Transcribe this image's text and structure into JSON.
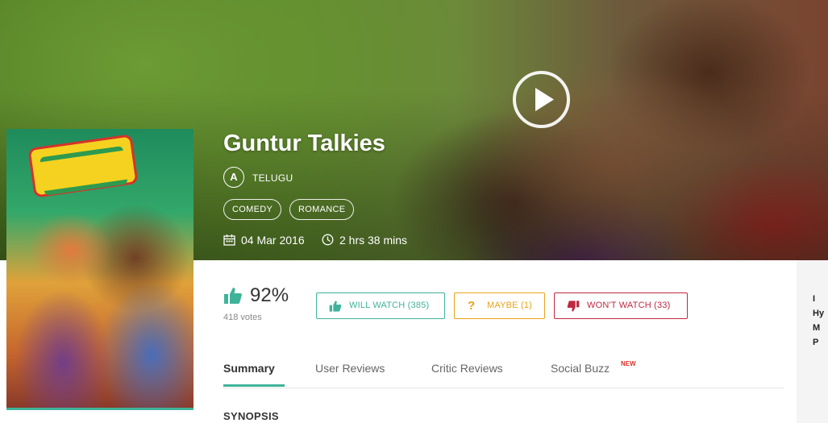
{
  "movie": {
    "title": "Guntur Talkies",
    "certificate": "A",
    "language": "TELUGU",
    "genres": [
      "COMEDY",
      "ROMANCE"
    ],
    "release_date": "04 Mar 2016",
    "duration": "2 hrs 38 mins"
  },
  "rating": {
    "percent": "92%",
    "votes": "418 votes"
  },
  "actions": {
    "will_watch": "WILL WATCH (385)",
    "maybe": "MAYBE (1)",
    "wont_watch": "WON'T WATCH (33)"
  },
  "tabs": [
    {
      "label": "Summary",
      "active": true
    },
    {
      "label": "User Reviews",
      "active": false
    },
    {
      "label": "Critic Reviews",
      "active": false
    },
    {
      "label": "Social Buzz",
      "active": false,
      "badge": "NEW"
    }
  ],
  "section": {
    "synopsis_title": "SYNOPSIS"
  },
  "side_panel": {
    "lines": [
      "I",
      "Hy",
      "M",
      "P"
    ]
  },
  "colors": {
    "accent": "#3fb39a",
    "maybe": "#e8a317",
    "wont_watch": "#c0283f"
  }
}
